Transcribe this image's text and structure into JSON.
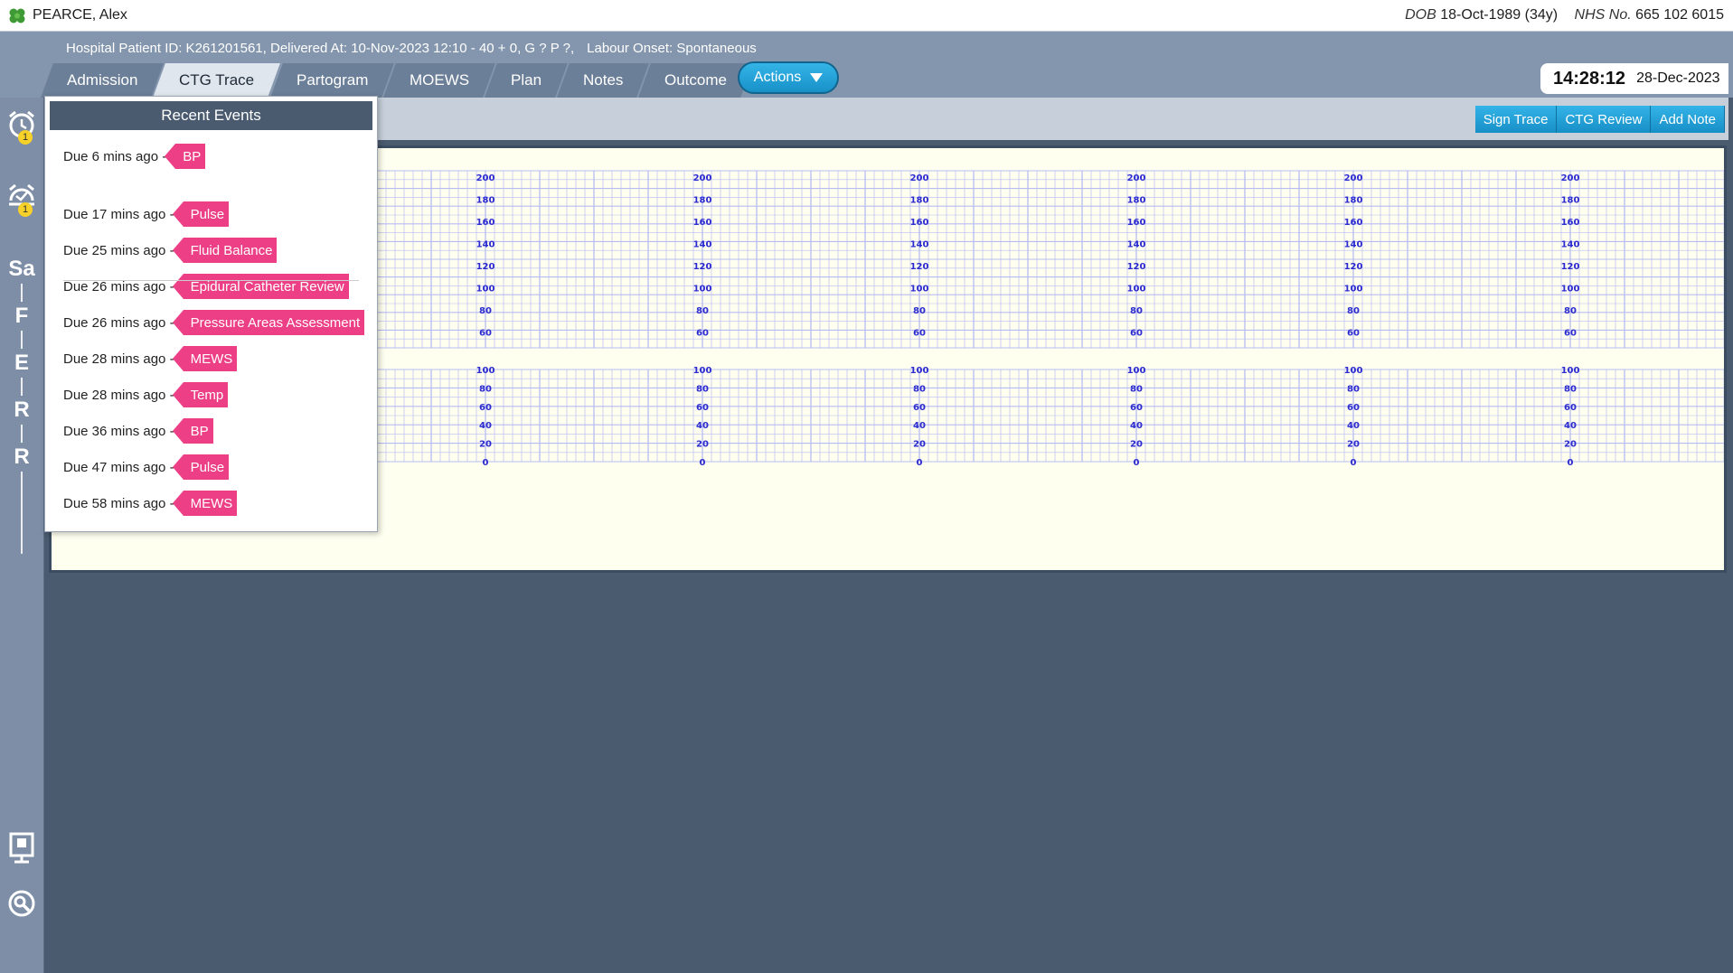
{
  "patient": {
    "name": "PEARCE, Alex",
    "dob_label": "DOB",
    "dob_value": "18-Oct-1989 (34y)",
    "nhs_label": "NHS No.",
    "nhs_value": "665 102 6015"
  },
  "header": {
    "hospital_id": "Hospital Patient ID: K261201561, Delivered At: 10-Nov-2023 12:10 - 40 + 0, G ? P ?,",
    "labour_onset": "Labour Onset: Spontaneous"
  },
  "tabs": [
    {
      "label": "Admission",
      "active": false
    },
    {
      "label": "CTG Trace",
      "active": true
    },
    {
      "label": "Partogram",
      "active": false
    },
    {
      "label": "MOEWS",
      "active": false
    },
    {
      "label": "Plan",
      "active": false
    },
    {
      "label": "Notes",
      "active": false
    },
    {
      "label": "Outcome",
      "active": false
    }
  ],
  "actions_label": "Actions",
  "clock": {
    "time": "14:28:12",
    "date": "28-Dec-2023"
  },
  "rail": {
    "alarm_badge": "1",
    "reminder_badge": "1",
    "letters": [
      "Sa",
      "F",
      "E",
      "R",
      "R"
    ]
  },
  "toolbar": {
    "sign_trace": "Sign Trace",
    "ctg_review": "CTG Review",
    "add_note": "Add Note"
  },
  "recent_events": {
    "title": "Recent Events",
    "items": [
      {
        "due": "Due 6 mins ago -",
        "tag": "BP"
      },
      {
        "due": "Due 17 mins ago -",
        "tag": "Pulse"
      },
      {
        "due": "Due 25 mins ago -",
        "tag": "Fluid Balance"
      },
      {
        "due": "Due 26 mins ago -",
        "tag": "Epidural Catheter Review"
      },
      {
        "due": "Due 26 mins ago -",
        "tag": "Pressure Areas Assessment"
      },
      {
        "due": "Due 28 mins ago -",
        "tag": "MEWS"
      },
      {
        "due": "Due 28 mins ago -",
        "tag": "Temp"
      },
      {
        "due": "Due 36 mins ago -",
        "tag": "BP"
      },
      {
        "due": "Due 47 mins ago -",
        "tag": "Pulse"
      },
      {
        "due": "Due 58 mins ago -",
        "tag": "MEWS"
      }
    ]
  },
  "ctg": {
    "fhr_ticks": [
      "200",
      "180",
      "160",
      "140",
      "120",
      "100",
      "80",
      "60"
    ],
    "toco_ticks": [
      "100",
      "80",
      "60",
      "40",
      "20",
      "0"
    ],
    "grid_color": "#b7bbf2",
    "tick_color": "#2b2bd0",
    "background": "#fffff0"
  },
  "colors": {
    "accent": "#1e9fd6",
    "event_tag": "#ec3f86",
    "header": "#8496ad",
    "content_bg": "#4a5a6f"
  }
}
